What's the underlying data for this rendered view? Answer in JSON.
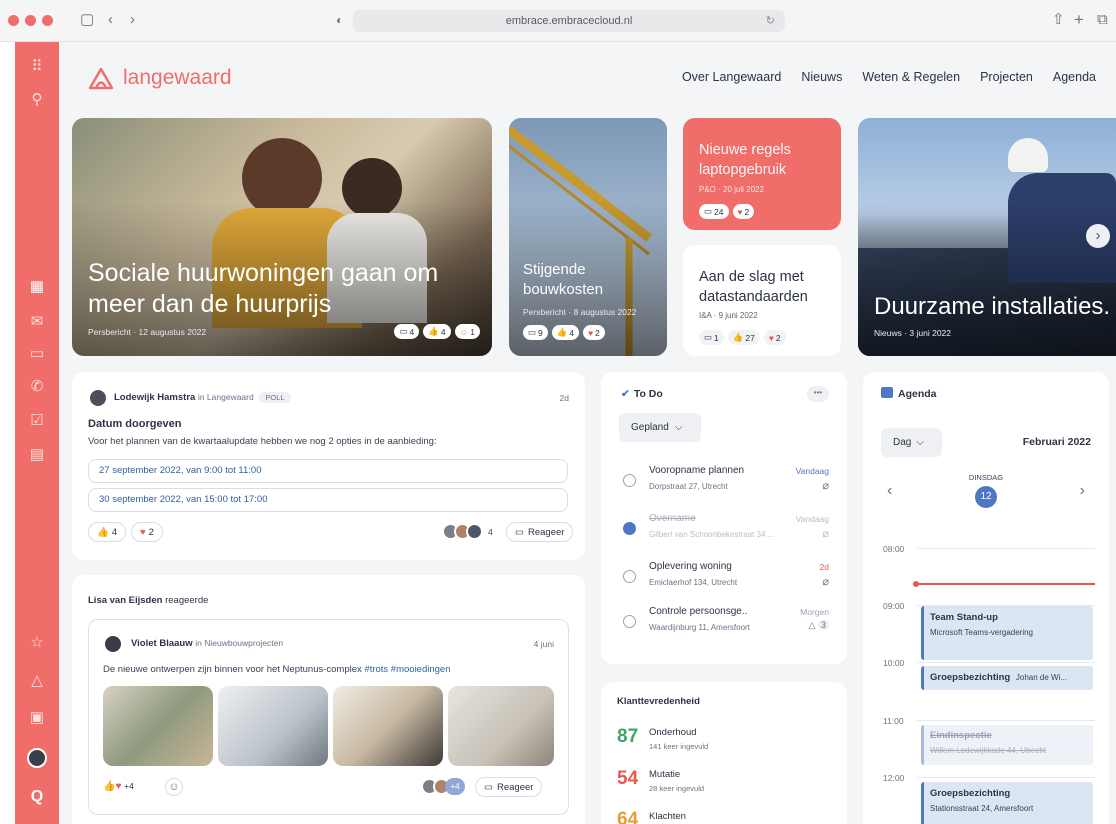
{
  "browser": {
    "url": "embrace.embracecloud.nl"
  },
  "brand": {
    "name": "langewaard",
    "accent": "#f06d6a"
  },
  "nav": {
    "items": [
      "Over Langewaard",
      "Nieuws",
      "Weten & Regelen",
      "Projecten",
      "Agenda"
    ]
  },
  "hero": {
    "main": {
      "title_line1": "Sociale huurwoningen gaan om",
      "title_line2": "meer dan de huurprijs",
      "meta": "Persbericht · 12 augustus 2022",
      "reactions": [
        "4",
        "4",
        "1"
      ]
    },
    "second": {
      "title_line1": "Stijgende",
      "title_line2": "bouwkosten",
      "meta": "Persbericht · 8 augustus 2022",
      "reactions": [
        "9",
        "4",
        "2"
      ]
    },
    "red": {
      "title_line1": "Nieuwe regels",
      "title_line2": "laptopgebruik",
      "meta": "P&O · 20 juli 2022",
      "reactions": [
        "24",
        "2"
      ]
    },
    "white": {
      "title_line1": "Aan de slag met",
      "title_line2": "datastandaarden",
      "meta": "I&A · 9 juni 2022",
      "reactions": [
        "1",
        "27",
        "2"
      ]
    },
    "right": {
      "title": "Duurzame installaties.",
      "meta": "Nieuws · 3 juni 2022"
    }
  },
  "poll": {
    "author": "Lodewijk Hamstra",
    "in_text": "in Langewaard",
    "tag": "POLL",
    "age": "2d",
    "title": "Datum doorgeven",
    "text": "Voor het plannen van de kwartaalupdate hebben we nog 2 opties in de aanbieding:",
    "options": [
      "27 september 2022, van 9:00 tot 11:00",
      "30 september 2022, van 15:00 tot 17:00"
    ],
    "likes": "4",
    "hearts": "2",
    "comment_count": "4",
    "reply_label": "Reageer"
  },
  "activity": {
    "actor": "Lisa van Eijsden",
    "action": "reageerde",
    "post": {
      "author": "Violet Blaauw",
      "in_text": "in Nieuwbouwprojecten",
      "date": "4 juni",
      "text": "De nieuwe ontwerpen zijn binnen voor het Neptunus-complex",
      "hashtags": "#trots #mooiedingen",
      "reaction_more": "+4",
      "avatar_more": "+4",
      "reply_label": "Reageer"
    }
  },
  "todo": {
    "title": "To Do",
    "filter": "Gepland",
    "items": [
      {
        "title": "Vooropname plannen",
        "sub": "Dorpstraat 27, Utrecht",
        "when": "Vandaag",
        "done": false
      },
      {
        "title": "Overname",
        "sub": "Gilbert van Schoonbekestraat 34 ...",
        "when": "Vandaag",
        "done": true
      },
      {
        "title": "Oplevering woning",
        "sub": "Emiclaerhof 134, Utrecht",
        "when": "2d",
        "done": false
      },
      {
        "title": "Controle persoonsge..",
        "sub": "Waardijnburg 11, Amersfoort",
        "when": "Morgen",
        "done": false,
        "count": "3"
      }
    ]
  },
  "satisfaction": {
    "title": "Klanttevredenheid",
    "items": [
      {
        "score": "87",
        "label": "Onderhoud",
        "sub": "141 keer ingevuld",
        "color": "#3fa66b"
      },
      {
        "score": "54",
        "label": "Mutatie",
        "sub": "28 keer ingevuld",
        "color": "#e8584f"
      },
      {
        "score": "64",
        "label": "Klachten",
        "sub": "",
        "color": "#e0a03c"
      }
    ]
  },
  "agenda": {
    "title": "Agenda",
    "view": "Dag",
    "month": "Februari 2022",
    "weekday": "DINSDAG",
    "day": "12",
    "hours": [
      "08:00",
      "09:00",
      "10:00",
      "11:00",
      "12:00"
    ],
    "events": [
      {
        "title": "Team Stand-up",
        "sub": "Microsoft Teams-vergadering"
      },
      {
        "title": "Groepsbezichting",
        "sub": "Johan de Wi..."
      },
      {
        "title": "Eindinspectie",
        "sub": "Willem Lodewijkkade 44, Utrecht"
      },
      {
        "title": "Groepsbezichting",
        "sub": "Stationsstraat 24, Amersfoort"
      }
    ]
  }
}
